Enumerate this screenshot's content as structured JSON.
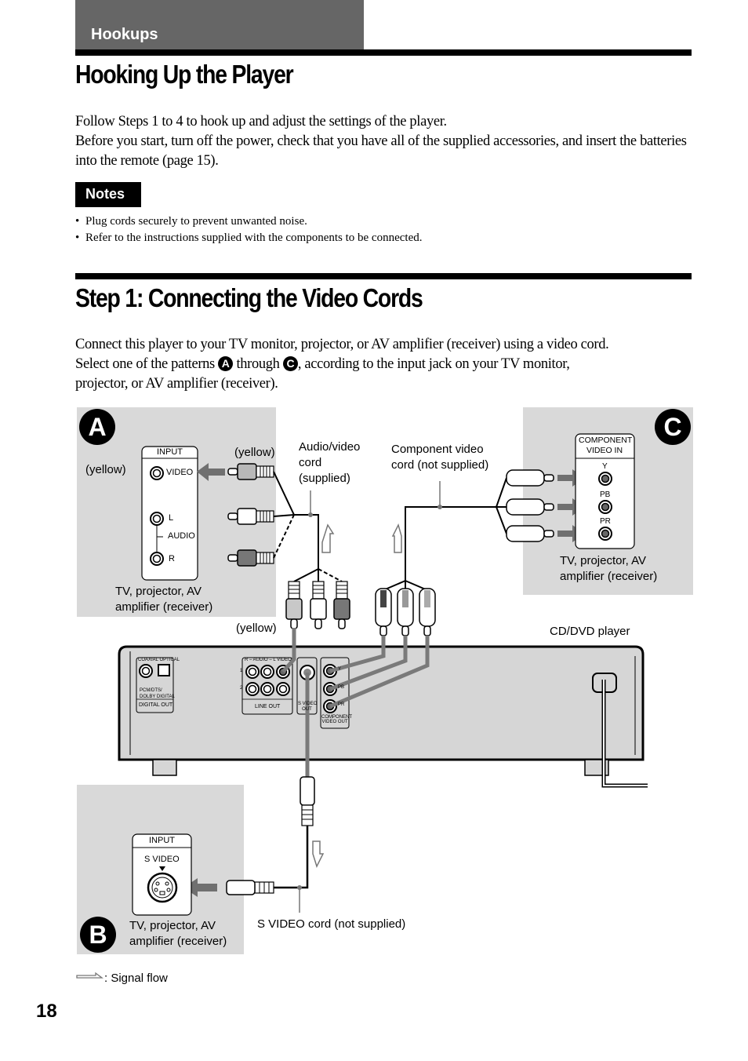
{
  "section": {
    "label": "Hookups"
  },
  "heading1": {
    "title": "Hooking Up the Player"
  },
  "intro": {
    "line1": "Follow Steps 1 to 4 to hook up and adjust the settings of the player.",
    "line2": "Before you start, turn off the power, check that you have all of the supplied accessories, and insert the batteries into the remote (page 15)."
  },
  "notes": {
    "label": "Notes",
    "items": [
      "Plug cords securely to prevent unwanted noise.",
      "Refer to the instructions supplied with the components to be connected."
    ]
  },
  "heading2": {
    "title": "Step 1: Connecting the Video Cords"
  },
  "step1": {
    "line1": "Connect this player to your TV monitor, projector, or AV amplifier (receiver) using a video cord.",
    "line2_before": "Select one of the patterns ",
    "marker_a": "A",
    "line2_middle": " through ",
    "marker_c": "C",
    "line2_after": ", according to the input jack on your TV monitor,",
    "line3": "projector, or AV amplifier (receiver)."
  },
  "diagram": {
    "pattern_a": {
      "marker": "A",
      "panel_title": "INPUT",
      "jack_video": "VIDEO",
      "jack_l": "L",
      "jack_audio": "AUDIO",
      "jack_r": "R",
      "yellow_left": "(yellow)",
      "yellow_plug": "(yellow)",
      "device_line1": "TV, projector, AV",
      "device_line2": "amplifier (receiver)"
    },
    "av_cord": {
      "line1": "Audio/video",
      "line2": "cord",
      "line3": "(supplied)"
    },
    "component_cord": {
      "line1": "Component video",
      "line2": "cord (not supplied)"
    },
    "yellow_bottom": "(yellow)",
    "pattern_c": {
      "marker": "C",
      "panel_title_line1": "COMPONENT",
      "panel_title_line2": "VIDEO IN",
      "jack_y": "Y",
      "jack_pb": "PB",
      "jack_pr": "PR",
      "device_line1": "TV, projector, AV",
      "device_line2": "amplifier (receiver)"
    },
    "player": {
      "label": "CD/DVD player",
      "digital_header": "COAXIAL  OPTICAL",
      "digital_note1": "PCM/DTS/",
      "digital_note2": "DOLBY DIGITAL",
      "digital_out": "DIGITAL OUT",
      "line_header": "R – AUDIO – L    VIDEO",
      "row1": "1",
      "row2": "2",
      "line_out": "LINE OUT",
      "svideo_out1": "S VIDEO",
      "svideo_out2": "OUT",
      "comp_y": "Y",
      "comp_pb": "PB",
      "comp_pr": "PR",
      "comp_out1": "COMPONENT",
      "comp_out2": "VIDEO OUT"
    },
    "pattern_b": {
      "marker": "B",
      "panel_title": "INPUT",
      "jack": "S VIDEO",
      "device_line1": "TV, projector, AV",
      "device_line2": "amplifier (receiver)"
    },
    "svideo_cord": "S VIDEO cord (not supplied)",
    "legend": ": Signal flow"
  },
  "page_number": "18"
}
